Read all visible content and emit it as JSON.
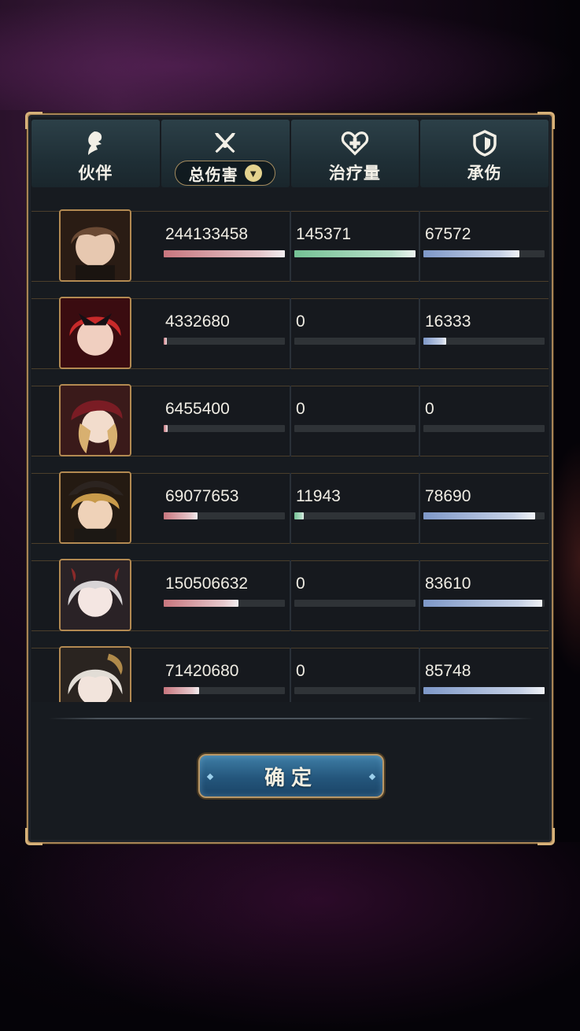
{
  "tabs": [
    {
      "label": "伙伴",
      "icon": "partner-icon"
    },
    {
      "label": "总伤害",
      "icon": "crossed-swords-icon",
      "dropdown": true
    },
    {
      "label": "治疗量",
      "icon": "heart-cross-icon"
    },
    {
      "label": "承伤",
      "icon": "shield-icon"
    }
  ],
  "rows": [
    {
      "avatar": "avatar-brown-hair-boy",
      "damage": "244133458",
      "damage_ratio": 1.0,
      "heal": "145371",
      "heal_ratio": 1.0,
      "taken": "67572",
      "taken_ratio": 0.79
    },
    {
      "avatar": "avatar-red-hair-mask",
      "damage": "4332680",
      "damage_ratio": 0.02,
      "heal": "0",
      "heal_ratio": 0,
      "taken": "16333",
      "taken_ratio": 0.19
    },
    {
      "avatar": "avatar-red-hood-girl",
      "damage": "6455400",
      "damage_ratio": 0.03,
      "heal": "0",
      "heal_ratio": 0,
      "taken": "0",
      "taken_ratio": 0
    },
    {
      "avatar": "avatar-blonde-hat-girl",
      "damage": "69077653",
      "damage_ratio": 0.28,
      "heal": "11943",
      "heal_ratio": 0.08,
      "taken": "78690",
      "taken_ratio": 0.92
    },
    {
      "avatar": "avatar-white-hair-horns",
      "damage": "150506632",
      "damage_ratio": 0.62,
      "heal": "0",
      "heal_ratio": 0,
      "taken": "83610",
      "taken_ratio": 0.98
    },
    {
      "avatar": "avatar-silver-hair-girl",
      "damage": "71420680",
      "damage_ratio": 0.29,
      "heal": "0",
      "heal_ratio": 0,
      "taken": "85748",
      "taken_ratio": 1.0
    }
  ],
  "confirm_label": "确定",
  "colors": {
    "damage": "#c8767e",
    "heal": "#74c194",
    "taken": "#7e98c8",
    "accent": "#a88456"
  }
}
